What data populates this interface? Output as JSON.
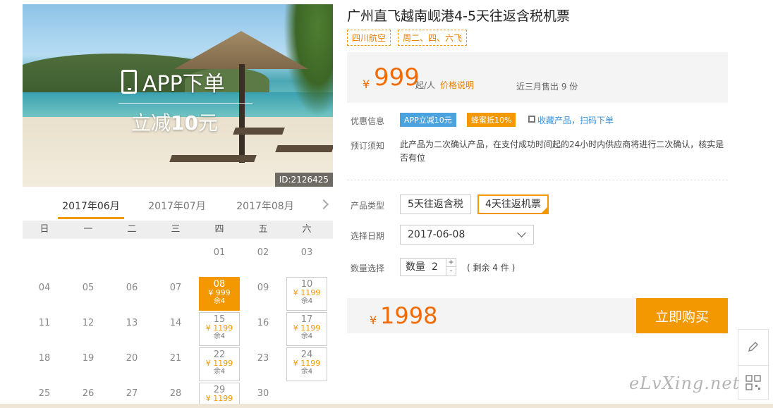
{
  "hero": {
    "app_text": "APP下单",
    "discount_prefix": "立减",
    "discount_amount": "10",
    "discount_unit": "元",
    "image_id": "ID:2126425"
  },
  "calendar": {
    "months": [
      "2017年06月",
      "2017年07月",
      "2017年08月"
    ],
    "active_month": "2017年06月",
    "weekdays": [
      "日",
      "一",
      "二",
      "三",
      "四",
      "五",
      "六"
    ],
    "days": [
      {
        "day": "01"
      },
      {
        "day": "02"
      },
      {
        "day": "03"
      },
      {
        "day": "04"
      },
      {
        "day": "05"
      },
      {
        "day": "06"
      },
      {
        "day": "07"
      },
      {
        "day": "08",
        "price": "¥ 999",
        "stock": "余4",
        "selected": true
      },
      {
        "day": "09"
      },
      {
        "day": "10",
        "price": "¥ 1199",
        "stock": "余4"
      },
      {
        "day": "11"
      },
      {
        "day": "12"
      },
      {
        "day": "13"
      },
      {
        "day": "14"
      },
      {
        "day": "15",
        "price": "¥ 1199",
        "stock": "余4"
      },
      {
        "day": "16"
      },
      {
        "day": "17",
        "price": "¥ 1199",
        "stock": "余4"
      },
      {
        "day": "18"
      },
      {
        "day": "19"
      },
      {
        "day": "20"
      },
      {
        "day": "21"
      },
      {
        "day": "22",
        "price": "¥ 1199",
        "stock": "余4"
      },
      {
        "day": "23"
      },
      {
        "day": "24",
        "price": "¥ 1199",
        "stock": "余4"
      },
      {
        "day": "25"
      },
      {
        "day": "26"
      },
      {
        "day": "27"
      },
      {
        "day": "28"
      },
      {
        "day": "29",
        "price": "¥ 1199",
        "stock": ""
      },
      {
        "day": "30"
      }
    ]
  },
  "product": {
    "title": "广州直飞越南岘港4-5天往返含税机票",
    "tags": [
      "四川航空",
      "周二、四、六飞"
    ],
    "currency": "¥",
    "price": "999",
    "price_unit": "起/人",
    "price_explain": "价格说明",
    "sold_text": "近三月售出 9 份"
  },
  "promo": {
    "label": "优惠信息",
    "badge1": "APP立减10元",
    "badge2": "蜂蜜抵10%",
    "collect_text": "收藏产品，扫码下单"
  },
  "booking_notice": {
    "label": "预订须知",
    "text": "此产品为二次确认产品，在支付成功时间起的24小时内供应商将进行二次确认，核实是否有位"
  },
  "options": {
    "type_label": "产品类型",
    "types": [
      "5天往返含税",
      "4天往返机票"
    ],
    "selected_type": "4天往返机票",
    "date_label": "选择日期",
    "date_value": "2017-06-08",
    "qty_label": "数量选择",
    "qty_text": "数量",
    "qty_value": "2",
    "qty_plus": "+",
    "qty_minus": "-",
    "remain_text": "( 剩余 4 件 )"
  },
  "purchase": {
    "currency": "¥",
    "total": "1998",
    "buy_label": "立即购买"
  },
  "watermark": "eLvXing.net",
  "colors": {
    "accent": "#f39800",
    "price": "#f26b00",
    "link": "#3a8fd6",
    "badge_blue": "#4aa3df"
  }
}
